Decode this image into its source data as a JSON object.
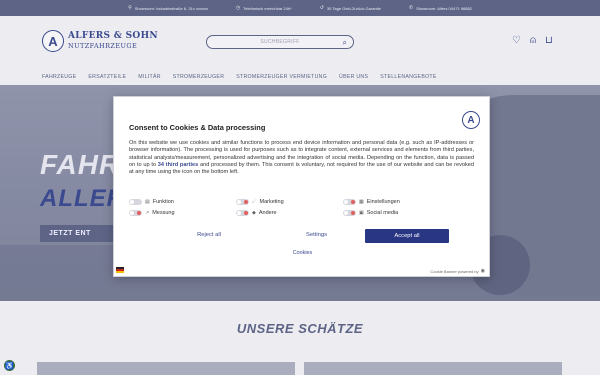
{
  "topbar": {
    "items": [
      {
        "icon": "pin-icon",
        "text": "Showroom: Industriestraße 6, 31x xxxxxx"
      },
      {
        "icon": "clock-icon",
        "text": "Telefonisch erreichbar 24h*"
      },
      {
        "icon": "return-icon",
        "text": "30 Tage Geld-Zurück-Garantie"
      },
      {
        "icon": "phone-icon",
        "text": "Showroom: Alfers 04471 98882"
      }
    ]
  },
  "header": {
    "logo_letter": "A",
    "logo_line1": "ALFERS & SOHN",
    "logo_line2": "NUTZFAHRZEUGE",
    "search_placeholder": "SUCHBEGRIFF",
    "icons": [
      "heart-icon",
      "user-icon",
      "cart-icon"
    ]
  },
  "nav": {
    "items": [
      "FAHRZEUGE",
      "ERSATZTEILE",
      "MILITÄR",
      "STROMERZEUGER",
      "STROMERZEUGER VERMIETUNG",
      "ÜBER UNS",
      "STELLENANGEBOTE"
    ]
  },
  "hero": {
    "title1": "FAHR",
    "title2": "ALLER",
    "button": "JETZT ENT"
  },
  "section": {
    "title": "UNSERE SCHÄTZE"
  },
  "consent": {
    "title": "Consent to Cookies & Data processing",
    "body_part1": "On this website we use cookies and similar functions to process end device information and personal data (e.g. such as IP-addresses or browser information). The processing is used for purposes such as to integrate content, external services and elements from third parties, statistical analysis/measurement, personalized advertising and the integration of social media. Depending on the function, data is passed on to up to ",
    "third_parties_link": "34 third parties",
    "body_part2": " and processed by them. This consent is voluntary, not required for the use of our website and can be revoked at any time using the icon on the bottom left.",
    "toggles": [
      {
        "label": "Funktion",
        "icon": "list-icon"
      },
      {
        "label": "Marketing",
        "icon": "marketing-icon"
      },
      {
        "label": "Einstellungen",
        "icon": "settings-icon"
      },
      {
        "label": "Messung",
        "icon": "measure-icon"
      },
      {
        "label": "Andere",
        "icon": "other-icon"
      },
      {
        "label": "Social media",
        "icon": "social-icon"
      }
    ],
    "reject": "Reject all",
    "settings": "Settings",
    "accept": "Accept all",
    "cookies_link": "Cookies",
    "powered": "Cookie Banner powered by"
  }
}
